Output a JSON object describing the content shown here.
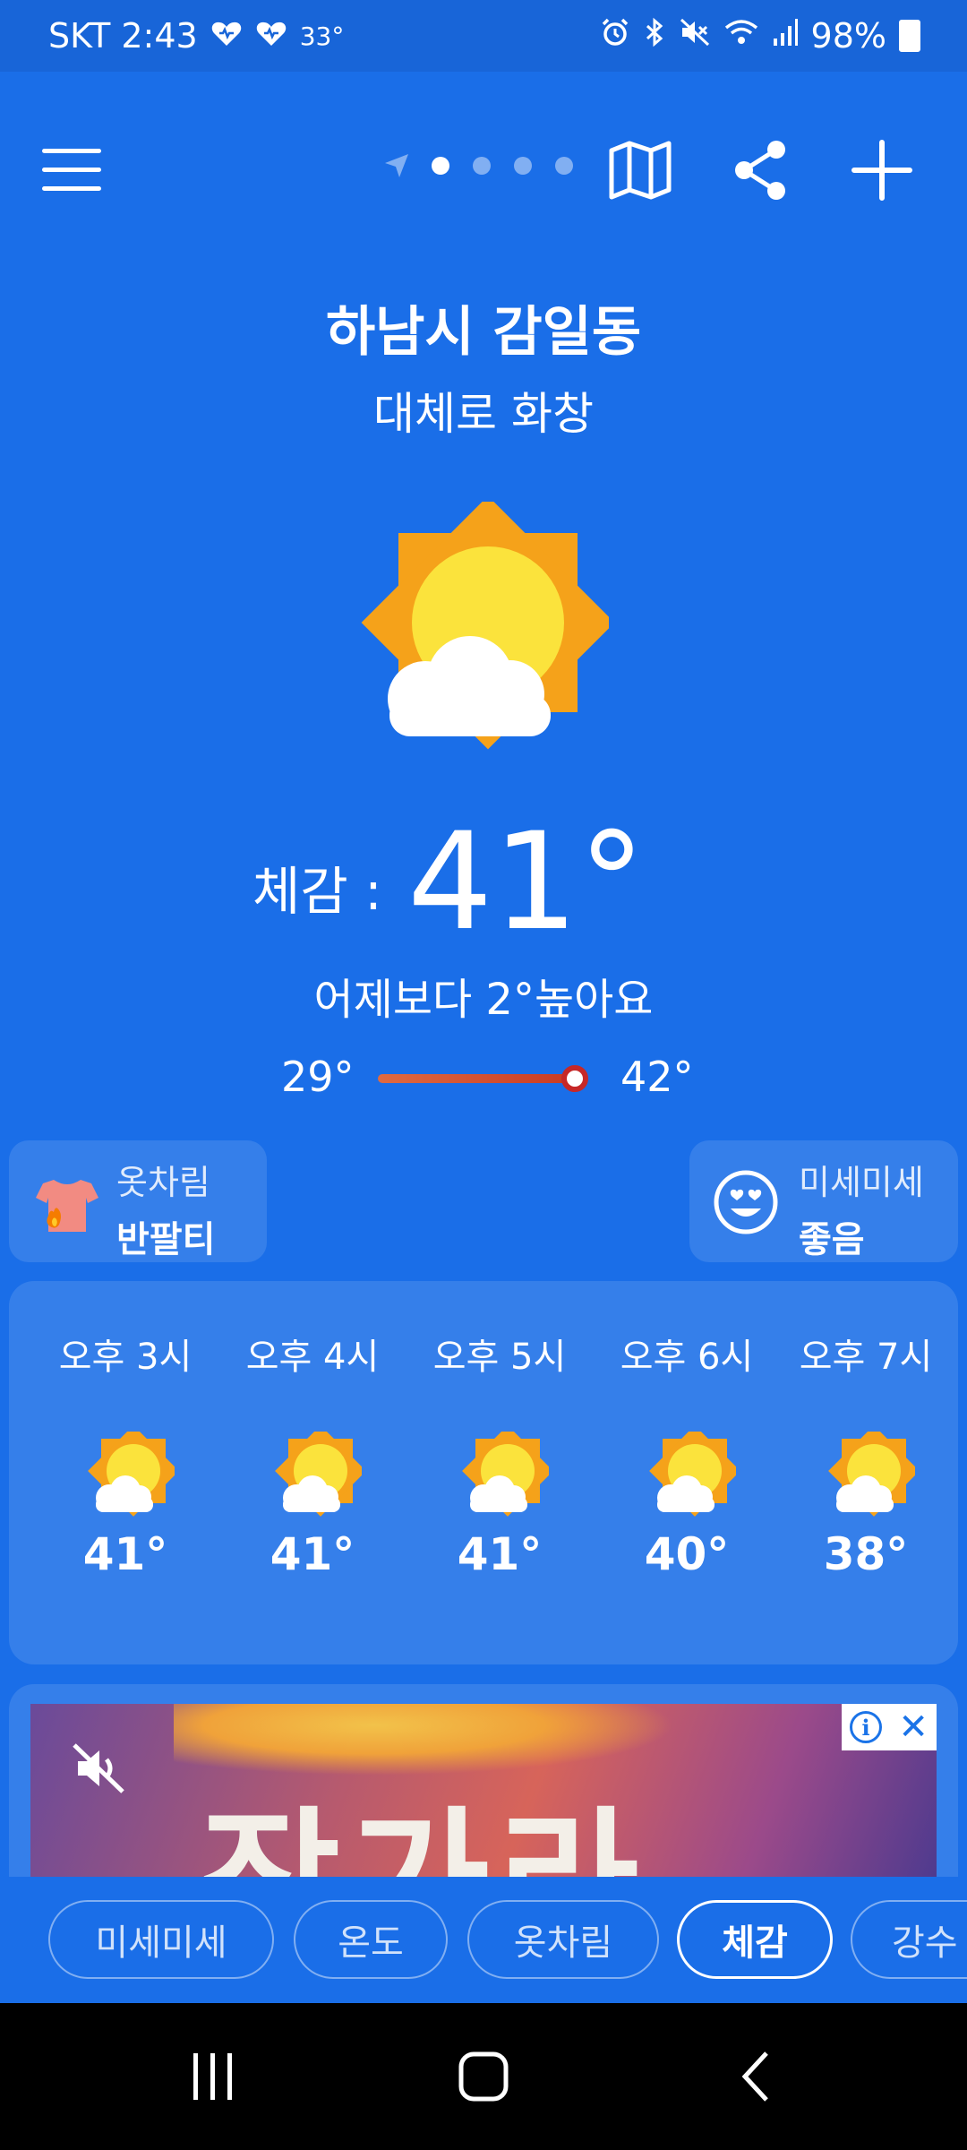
{
  "status_bar": {
    "carrier_time": "SKT 2:43",
    "temp_small": "33°",
    "battery": "98%"
  },
  "toolbar": {
    "page_count": 4,
    "active_page": 0
  },
  "location": "하남시 감일동",
  "condition": "대체로 화창",
  "feels": {
    "label": "체감 :",
    "value": "41°"
  },
  "compare_text": "어제보다 2°높아요",
  "range": {
    "min": "29°",
    "max": "42°"
  },
  "chips": {
    "outfit": {
      "title": "옷차림",
      "value": "반팔티"
    },
    "dust": {
      "title": "미세미세",
      "value": "좋음"
    }
  },
  "hourly": [
    {
      "time": "오후 3시",
      "temp": "41°"
    },
    {
      "time": "오후 4시",
      "temp": "41°"
    },
    {
      "time": "오후 5시",
      "temp": "41°"
    },
    {
      "time": "오후 6시",
      "temp": "40°"
    },
    {
      "time": "오후 7시",
      "temp": "38°"
    }
  ],
  "ad": {
    "headline": "잠가라"
  },
  "tabs": [
    "미세미세",
    "온도",
    "옷차림",
    "체감",
    "강수"
  ],
  "active_tab": "체감"
}
